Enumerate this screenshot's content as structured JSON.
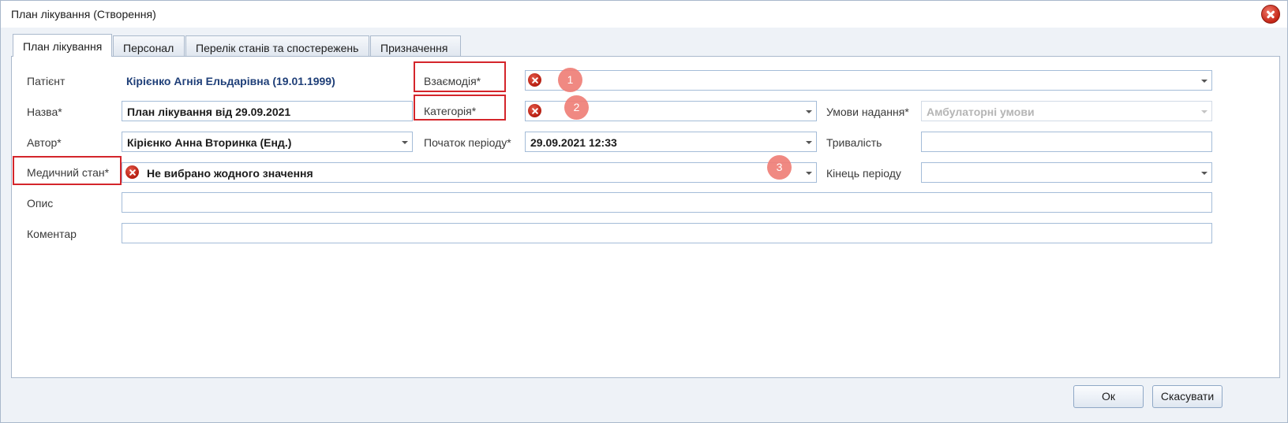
{
  "window": {
    "title": "План лікування (Створення)"
  },
  "tabs": [
    {
      "label": "План лікування",
      "active": true
    },
    {
      "label": "Персонал"
    },
    {
      "label": "Перелік станів та спостережень"
    },
    {
      "label": "Призначення"
    }
  ],
  "form": {
    "patient_label": "Патієнт",
    "patient_value": "Кірієнко Агнія Ельдарівна (19.01.1999)",
    "name_label": "Назва*",
    "name_value": "План лікування від 29.09.2021",
    "author_label": "Автор*",
    "author_value": "Кірієнко Анна Вторинка (Енд.)",
    "condition_label": "Медичний стан*",
    "condition_value": "Не вибрано жодного значення",
    "description_label": "Опис",
    "description_value": "",
    "comment_label": "Коментар",
    "comment_value": "",
    "interaction_label": "Взаємодія*",
    "interaction_value": "",
    "category_label": "Категорія*",
    "category_value": "",
    "period_start_label": "Початок періоду*",
    "period_start_value": "29.09.2021 12:33",
    "conditions_label": "Умови надання*",
    "conditions_value": "Амбулаторні умови",
    "duration_label": "Тривалість",
    "duration_value": "",
    "period_end_label": "Кінець періоду",
    "period_end_value": ""
  },
  "annotations": [
    "1",
    "2",
    "3"
  ],
  "buttons": {
    "ok": "Ок",
    "cancel": "Скасувати"
  },
  "colors": {
    "highlight": "#d4252b",
    "badge": "#ef7f78",
    "link_text": "#1f3f78"
  }
}
